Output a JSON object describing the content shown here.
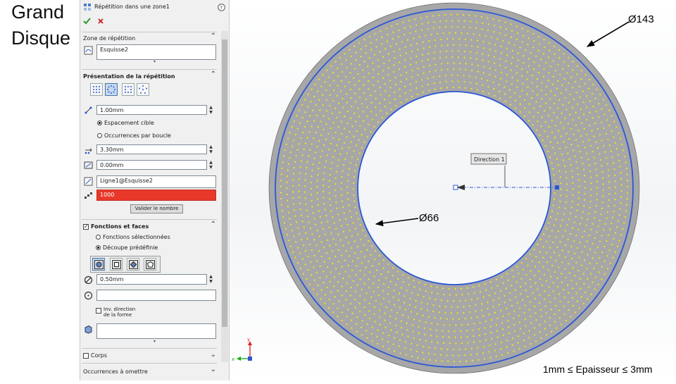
{
  "slide": {
    "title_line1": "Grand",
    "title_line2": "Disque",
    "footnote": "1mm ≤ Epaisseur ≤ 3mm"
  },
  "panel": {
    "title": "Répétition dans une zone1",
    "help_icon": "?",
    "ok_icon": "checkmark-icon",
    "cancel_icon": "x-icon",
    "zone_section": "Zone de répétition",
    "zone_value": "Esquisse2",
    "layout_section": "Présentation de la répétition",
    "spacing_value": "1.00mm",
    "radio_target_spacing": "Espacement cible",
    "radio_instances_per_loop": "Occurrences par boucle",
    "row_spacing_value": "3.30mm",
    "angle_value": "0.00mm",
    "direction_value": "Ligne1@Esquisse2",
    "instances_value": "1000",
    "validate_button": "Valider le nombre",
    "features_section": "Fonctions et faces",
    "radio_selected_features": "Fonctions sélectionnées",
    "radio_predefined_cut": "Découpe prédéfinie",
    "diameter_value": "0.50mm",
    "invert_label_line1": "Inv. direction",
    "invert_label_line2": "de la forme",
    "bodies_section": "Corps",
    "skip_section": "Occurrences à omettre"
  },
  "viewport": {
    "label_outer": "Ø143",
    "label_inner": "Ø66",
    "direction_tag": "Direction 1",
    "triad_x": "x",
    "triad_y": "y",
    "colors": {
      "disc": "#a7a7a7",
      "sketch": "#2a57d6",
      "dots": "#ece12c",
      "warning": "#e8382a"
    }
  }
}
